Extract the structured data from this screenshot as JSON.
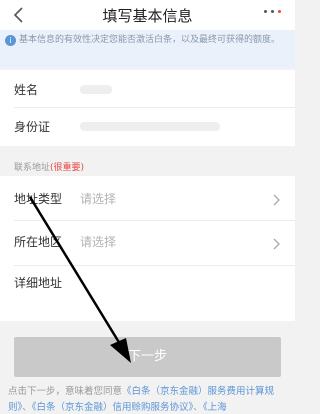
{
  "header": {
    "title": "填写基本信息"
  },
  "notice": {
    "text": "基本信息的有效性决定您能否激活白条，以及最终可获得的额度。"
  },
  "identity": {
    "name_label": "姓名",
    "id_label": "身份证"
  },
  "contact": {
    "section_label": "联系地址",
    "required_mark": "(很重要)",
    "address_type_label": "地址类型",
    "address_type_placeholder": "请选择",
    "region_label": "所在地区",
    "region_placeholder": "请选择",
    "detail_label": "详细地址"
  },
  "footer": {
    "next_label": "下一步",
    "agree_prefix": "点击下一步，意味着您同意",
    "link1": "《白条（京东金融）服务费用计算规则》",
    "sep": "、",
    "link2": "《白条（京东金融）信用赊购服务协议》",
    "link3": "《上海"
  },
  "icons": {
    "back": "chevron-left-icon",
    "more": "more-dots-icon",
    "info": "info-icon",
    "chevron": "chevron-right-icon"
  },
  "colors": {
    "accent_blue": "#5a95d6",
    "required_red": "#e5483e",
    "disabled_button": "#c9c9c9"
  }
}
